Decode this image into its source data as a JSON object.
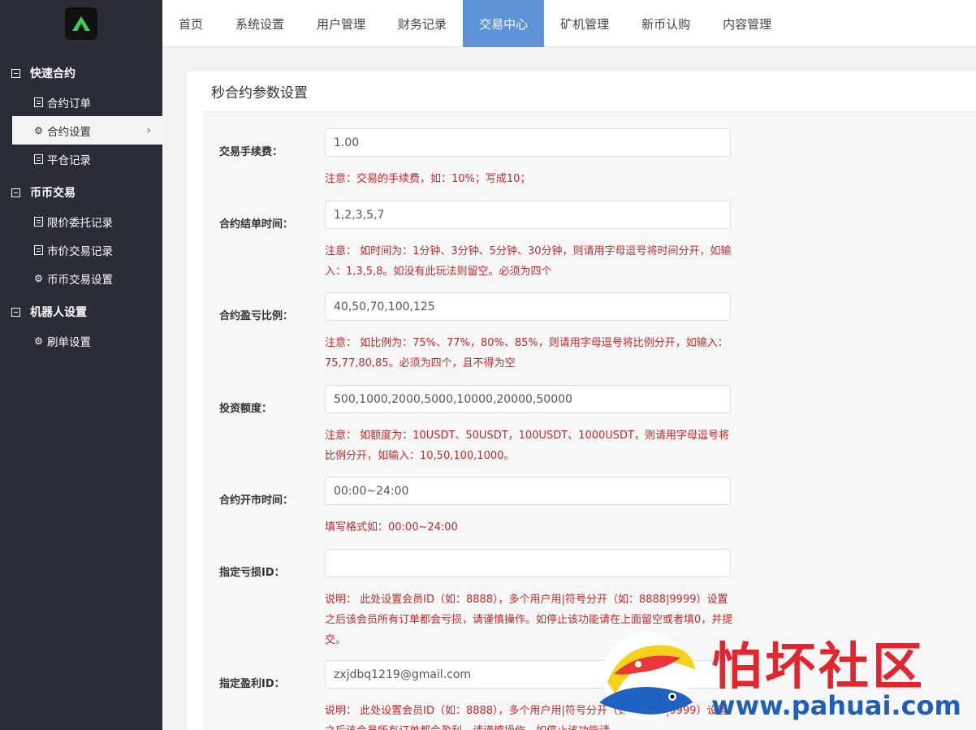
{
  "sidebar": {
    "groups": [
      {
        "title": "快速合约",
        "items": [
          {
            "label": "合约订单",
            "icon": "document-icon"
          },
          {
            "label": "合约设置",
            "icon": "gear-icon"
          },
          {
            "label": "平仓记录",
            "icon": "document-icon"
          }
        ]
      },
      {
        "title": "币币交易",
        "items": [
          {
            "label": "限价委托记录",
            "icon": "document-icon"
          },
          {
            "label": "市价交易记录",
            "icon": "document-icon"
          },
          {
            "label": "币币交易设置",
            "icon": "gear-icon"
          }
        ]
      },
      {
        "title": "机器人设置",
        "items": [
          {
            "label": "刷单设置",
            "icon": "gear-icon"
          }
        ]
      }
    ]
  },
  "topnav": {
    "tabs": [
      "首页",
      "系统设置",
      "用户管理",
      "财务记录",
      "交易中心",
      "矿机管理",
      "新币认购",
      "内容管理"
    ],
    "active": "交易中心"
  },
  "page": {
    "title": "秒合约参数设置"
  },
  "form": {
    "fields": [
      {
        "label": "交易手续费：",
        "value": "1.00",
        "note": "注意：交易的手续费，如：10%；写成10；"
      },
      {
        "label": "合约结单时间：",
        "value": "1,2,3,5,7",
        "note": "注意： 如时间为：1分钟、3分钟、5分钟、30分钟，则请用字母逗号将时间分开，如输入：1,3,5,8。如没有此玩法则留空。必须为四个"
      },
      {
        "label": "合约盈亏比例：",
        "value": "40,50,70,100,125",
        "note": "注意： 如比例为：75%、77%，80%、85%，则请用字母逗号将比例分开，如输入：75,77,80,85。必须为四个，且不得为空"
      },
      {
        "label": "投资额度：",
        "value": "500,1000,2000,5000,10000,20000,50000",
        "note": "注意： 如额度为：10USDT、50USDT，100USDT、1000USDT，则请用字母逗号将比例分开，如输入：10,50,100,1000。"
      },
      {
        "label": "合约开市时间：",
        "value": "00:00~24:00",
        "note": "填写格式如：00:00~24:00"
      },
      {
        "label": "指定亏损ID：",
        "value": "",
        "note": "说明： 此处设置会员ID（如：8888），多个用户用|符号分开（如：8888|9999）设置之后该会员所有订单都会亏损，请谨慎操作。如停止该功能请在上面留空或者填0，并提交。"
      },
      {
        "label": "指定盈利ID：",
        "value": "zxjdbq1219@gmail.com",
        "note": "说明： 此处设置会员ID（如：8888），多个用户用|符号分开（如：8888|9999）设置之后该会员所有订单都会盈利，请谨慎操作。如停止该功能请"
      }
    ]
  },
  "watermark": {
    "title": "怕坏社区",
    "url": "www.pahuai.com"
  },
  "colors": {
    "sidebar_bg": "#2a2c37",
    "active_tab": "#5e93d8",
    "note_red": "#c12a2a"
  }
}
